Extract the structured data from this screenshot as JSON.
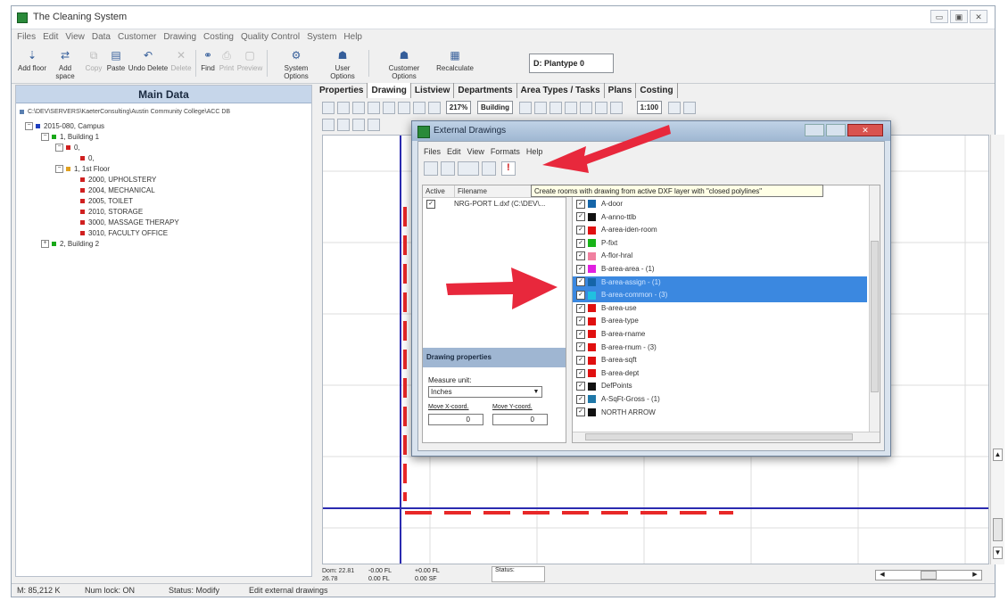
{
  "window": {
    "title": "The Cleaning System"
  },
  "menu": [
    "Files",
    "Edit",
    "View",
    "Data",
    "Customer",
    "Drawing",
    "Costing",
    "Quality Control",
    "System",
    "Help"
  ],
  "toolbar": {
    "buttons": [
      {
        "label": "Add floor",
        "icon": "add-floor-icon"
      },
      {
        "label": "Add space",
        "icon": "add-space-icon"
      },
      {
        "label": "Copy",
        "icon": "copy-icon"
      },
      {
        "label": "Paste",
        "icon": "paste-icon"
      },
      {
        "label": "Undo Delete",
        "icon": "undo-icon"
      },
      {
        "label": "Delete",
        "icon": "delete-icon"
      },
      {
        "label": "Find",
        "icon": "binoculars-icon"
      },
      {
        "label": "Print",
        "icon": "print-icon"
      },
      {
        "label": "Preview",
        "icon": "preview-icon"
      },
      {
        "label": "System Options",
        "icon": "system-options-icon"
      },
      {
        "label": "User Options",
        "icon": "user-options-icon"
      },
      {
        "label": "Customer Options",
        "icon": "customer-options-icon"
      },
      {
        "label": "Recalculate",
        "icon": "recalculate-icon"
      }
    ],
    "plantype": "D: Plantype 0"
  },
  "left_panel": {
    "header": "Main Data",
    "path": "C:\\DEV\\SERVERS\\KaeterConsulting\\Austin Community College\\ACC DB",
    "tree": [
      {
        "label": "2015-080, Campus",
        "toggle": "−",
        "color": "#1f3fbf"
      },
      {
        "label": "1, Building 1",
        "toggle": "−",
        "color": "#18a818"
      },
      {
        "label": "0,",
        "toggle": "−",
        "color": "#d02020"
      },
      {
        "label": "0,",
        "toggle": "",
        "color": "#d02020"
      },
      {
        "label": "1, 1st Floor",
        "toggle": "−",
        "color": "#e0a020"
      },
      {
        "label": "2000, UPHOLSTERY",
        "toggle": "",
        "color": "#d02020"
      },
      {
        "label": "2004, MECHANICAL",
        "toggle": "",
        "color": "#d02020"
      },
      {
        "label": "2005, TOILET",
        "toggle": "",
        "color": "#d02020"
      },
      {
        "label": "2010, STORAGE",
        "toggle": "",
        "color": "#d02020"
      },
      {
        "label": "3000, MASSAGE THERAPY",
        "toggle": "",
        "color": "#d02020"
      },
      {
        "label": "3010, FACULTY OFFICE",
        "toggle": "",
        "color": "#d02020"
      },
      {
        "label": "2, Building 2",
        "toggle": "+",
        "color": "#18a818"
      }
    ]
  },
  "tabs": [
    "Properties",
    "Drawing",
    "Listview",
    "Departments",
    "Area Types / Tasks",
    "Plans",
    "Costing"
  ],
  "drawing_toolbar": {
    "zoom": "217%",
    "level": "Building",
    "scale": "1:100"
  },
  "coords": {
    "x_label": "Dom: 22.81",
    "y_label": "26.78",
    "fl1": "-0.00 FL",
    "fl2": "+0.00 FL",
    "fl3": "0.00 FL",
    "fl4": "0.00 SF",
    "status": "Status:"
  },
  "statusbar": {
    "memory": "M: 85,212 K",
    "numlock": "Num lock: ON",
    "status": "Status: Modify",
    "action": "Edit external drawings"
  },
  "dialog": {
    "title": "External Drawings",
    "menu": [
      "Files",
      "Edit",
      "View",
      "Formats",
      "Help"
    ],
    "tooltip": "Create rooms with drawing from active DXF layer with \"closed polylines\"",
    "files_header": {
      "active": "Active",
      "filename": "Filename"
    },
    "file_row": "NRG-PORT L.dxf (C:\\DEV\\...",
    "props_header": "Drawing properties",
    "measure_label": "Measure unit:",
    "measure_value": "Inches",
    "move_x_label": "Move X-coord.",
    "move_y_label": "Move Y-coord.",
    "move_x": "0",
    "move_y": "0",
    "layers": [
      {
        "name": "A-door",
        "color": "#1565a8",
        "sel": false
      },
      {
        "name": "A-anno-ttlb",
        "color": "#111111",
        "sel": false
      },
      {
        "name": "A-area-iden-room",
        "color": "#e01010",
        "sel": false
      },
      {
        "name": "P-fixt",
        "color": "#18b418",
        "sel": false
      },
      {
        "name": "A-flor-hral",
        "color": "#f080a0",
        "sel": false
      },
      {
        "name": "B-area-area - (1)",
        "color": "#e020e0",
        "sel": false
      },
      {
        "name": "B-area-assign - (1)",
        "color": "#1565a8",
        "sel": true
      },
      {
        "name": "B-area-common - (3)",
        "color": "#20c0e0",
        "sel": true
      },
      {
        "name": "B-area-use",
        "color": "#e01010",
        "sel": false
      },
      {
        "name": "B-area-type",
        "color": "#e01010",
        "sel": false
      },
      {
        "name": "B-area-rname",
        "color": "#e01010",
        "sel": false
      },
      {
        "name": "B-area-rnum - (3)",
        "color": "#e01010",
        "sel": false
      },
      {
        "name": "B-area-sqft",
        "color": "#e01010",
        "sel": false
      },
      {
        "name": "B-area-dept",
        "color": "#e01010",
        "sel": false
      },
      {
        "name": "DefPoints",
        "color": "#111111",
        "sel": false
      },
      {
        "name": "A-SqFt-Gross - (1)",
        "color": "#1f78a8",
        "sel": false
      },
      {
        "name": "NORTH ARROW",
        "color": "#111111",
        "sel": false
      }
    ]
  },
  "accent": "#e8283c"
}
